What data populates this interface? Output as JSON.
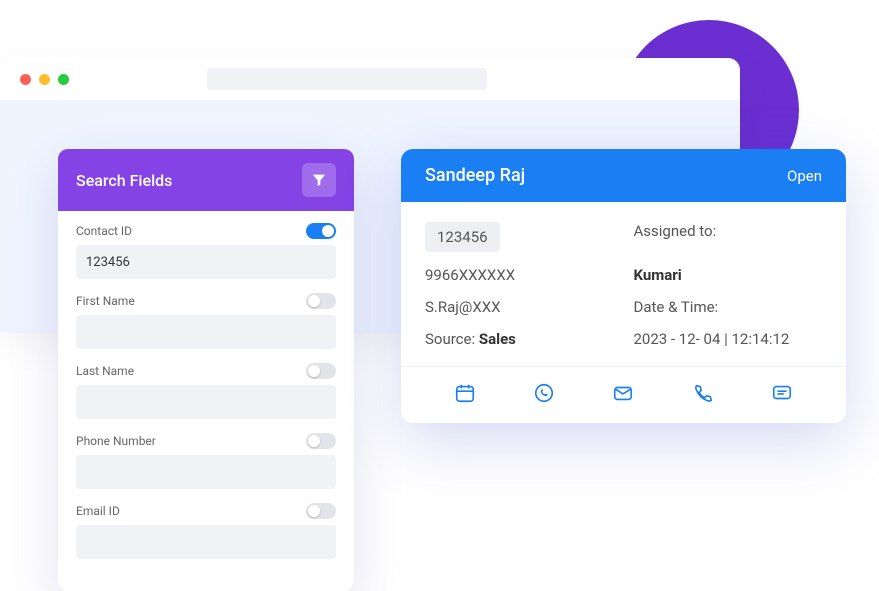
{
  "search_panel": {
    "title": "Search Fields",
    "fields": [
      {
        "label": "Contact ID",
        "value": "123456",
        "enabled": true
      },
      {
        "label": "First Name",
        "value": "",
        "enabled": false
      },
      {
        "label": "Last Name",
        "value": "",
        "enabled": false
      },
      {
        "label": "Phone Number",
        "value": "",
        "enabled": false
      },
      {
        "label": "Email ID",
        "value": "",
        "enabled": false
      }
    ]
  },
  "contact_card": {
    "name": "Sandeep Raj",
    "status": "Open",
    "id": "123456",
    "phone": "9966XXXXXX",
    "email": "S.Raj@XXX",
    "source_label": "Source: ",
    "source_value": "Sales",
    "assigned_label": "Assigned to:",
    "assigned_value": "Kumari",
    "datetime_label": "Date & Time:",
    "datetime_value": "2023 - 12- 04 | 12:14:12"
  }
}
